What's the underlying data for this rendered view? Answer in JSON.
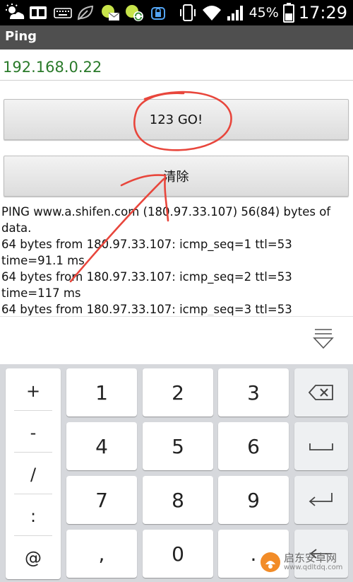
{
  "status_bar": {
    "battery_percent": "45%",
    "time": "17:29",
    "icons": [
      "weather-icon",
      "sim-card-icon",
      "keyboard-icon",
      "leaf-icon",
      "mail-notification-icon",
      "sync-notification-icon",
      "app-lock-icon",
      "vibrate-icon",
      "wifi-icon",
      "signal-icon",
      "battery-icon"
    ]
  },
  "app_bar": {
    "title": "Ping"
  },
  "ip_field": {
    "value": "192.168.0.22"
  },
  "buttons": {
    "go_label": "123 GO!",
    "clear_label": "清除"
  },
  "output_lines": [
    "PING www.a.shifen.com (180.97.33.107) 56(84) bytes of data.",
    "64 bytes from 180.97.33.107: icmp_seq=1 ttl=53 time=91.1 ms",
    "64 bytes from 180.97.33.107: icmp_seq=2 ttl=53 time=117 ms",
    "64 bytes from 180.97.33.107: icmp_seq=3 ttl=53"
  ],
  "keyboard": {
    "symbols": [
      "+",
      "-",
      "/",
      ":",
      "@"
    ],
    "digits": [
      "1",
      "2",
      "3",
      "4",
      "5",
      "6",
      "7",
      "8",
      "9",
      ",",
      "0",
      "."
    ],
    "function_keys": [
      "backspace-icon",
      "space-icon",
      "enter-icon"
    ]
  },
  "watermark": {
    "text": "启东安卓网",
    "url": "www.qdltdq.com"
  },
  "colors": {
    "accent_red": "#e8463c",
    "ip_text": "#2a7a2a",
    "action_bar": "#4f4f4f"
  }
}
